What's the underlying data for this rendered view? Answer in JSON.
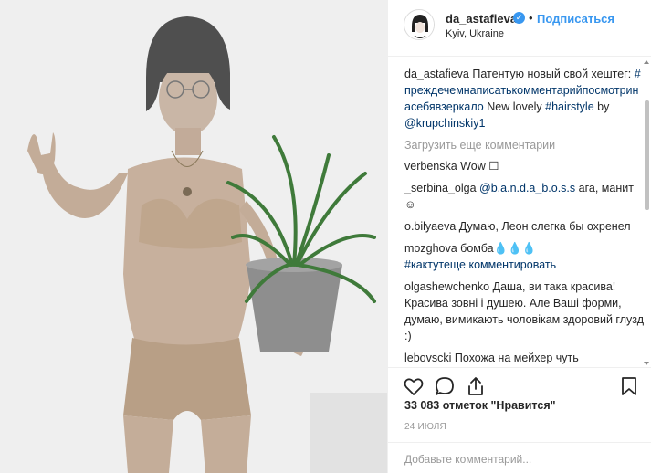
{
  "post": {
    "username": "da_astafieva",
    "verified_icon": "verified-badge-icon",
    "follow_label": "Подписаться",
    "separator": "•",
    "location": "Kyiv, Ukraine"
  },
  "caption": {
    "username": "da_astafieva",
    "text_1": "Патентую новый свой хештег:",
    "hashtag_1": "#преждечемнаписатькомментарийпосмотринасебявзеркало",
    "text_2": "New lovely",
    "hashtag_2": "#hairstyle",
    "text_3": "by",
    "mention": "@krupchinskiy1"
  },
  "load_more": "Загрузить еще комментарии",
  "comments": [
    {
      "user": "verbenska",
      "text": "Wow ☐"
    },
    {
      "user": "_serbina_olga",
      "mention": "@b.a.n.d.a_b.o.s.s",
      "text": "ага, манит ☺"
    },
    {
      "user": "o.bilyaeva",
      "text": "Думаю, Леон слегка бы охренел"
    },
    {
      "user": "mozghova",
      "text": "бомба💧💧💧",
      "hashtag": "#кактутеще комментировать"
    },
    {
      "user": "olgashewchenko",
      "text": "Даша, ви така красива! Красива зовні і душею. Але Ваші форми, думаю, вимикають чоловікам здоровий глузд :)"
    },
    {
      "user": "lebovscki",
      "text": "Похожа на мейхер чуть"
    }
  ],
  "likes_text": "33 083 отметок \"Нравится\"",
  "date": "24 ИЮЛЯ",
  "add_comment_placeholder": "Добавьте комментарий...",
  "icons": {
    "like": "heart-icon",
    "comment": "comment-icon",
    "share": "share-icon",
    "save": "bookmark-icon"
  },
  "colors": {
    "link": "#3897f0",
    "hashtag": "#003569",
    "muted": "#999999",
    "text": "#262626"
  }
}
